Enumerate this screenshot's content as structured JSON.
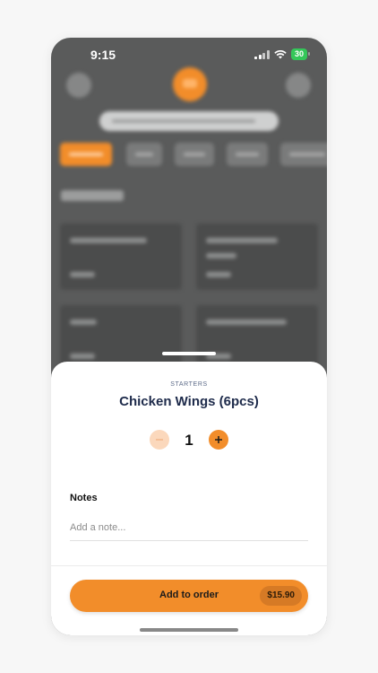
{
  "status_bar": {
    "time": "9:15",
    "battery": "30"
  },
  "sheet": {
    "category": "STARTERS",
    "item_name": "Chicken Wings (6pcs)",
    "quantity": "1",
    "notes_label": "Notes",
    "notes_placeholder": "Add a note...",
    "notes_value": "",
    "cta_label": "Add to order",
    "cta_price": "$15.90"
  },
  "colors": {
    "accent": "#f28d2a",
    "title": "#1e2b4b",
    "battery": "#34c759"
  }
}
